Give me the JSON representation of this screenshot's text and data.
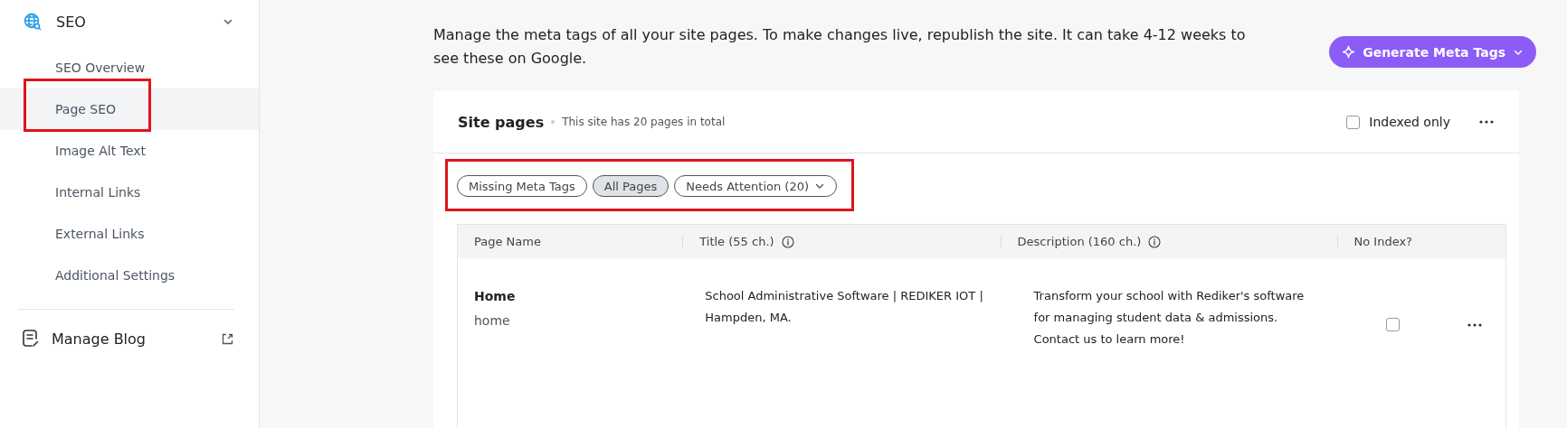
{
  "sidebar": {
    "section": {
      "label": "SEO",
      "expanded": true
    },
    "items": [
      {
        "label": "SEO Overview",
        "selected": false
      },
      {
        "label": "Page SEO",
        "selected": true,
        "highlighted": true
      },
      {
        "label": "Image Alt Text",
        "selected": false
      },
      {
        "label": "Internal Links",
        "selected": false
      },
      {
        "label": "External Links",
        "selected": false
      },
      {
        "label": "Additional Settings",
        "selected": false
      }
    ],
    "blog_link": {
      "label": "Manage Blog"
    }
  },
  "header": {
    "description": "Manage the meta tags of all your site pages. To make changes live, republish the site. It can take 4-12 weeks to see these on Google.",
    "generate_button": "Generate Meta Tags"
  },
  "card": {
    "title": "Site pages",
    "subtitle": "This site has 20 pages in total",
    "indexed_only": {
      "label": "Indexed only",
      "checked": false
    },
    "filters_highlighted": true,
    "filters": [
      {
        "label": "Missing Meta Tags",
        "selected": false
      },
      {
        "label": "All Pages",
        "selected": true
      },
      {
        "label": "Needs Attention (20)",
        "selected": false,
        "dropdown": true
      }
    ],
    "table": {
      "columns": [
        {
          "label": "Page Name",
          "info": false
        },
        {
          "label": "Title (55 ch.)",
          "info": true
        },
        {
          "label": "Description (160 ch.)",
          "info": true
        },
        {
          "label": "No Index?",
          "info": false
        }
      ],
      "rows": [
        {
          "name": "Home",
          "slug": "home",
          "title": "School Administrative Software | REDIKER IOT | Hampden, MA.",
          "description": "Transform your school with Rediker's software for managing student data & admissions. Contact us to learn more!",
          "no_index": false
        }
      ]
    }
  }
}
